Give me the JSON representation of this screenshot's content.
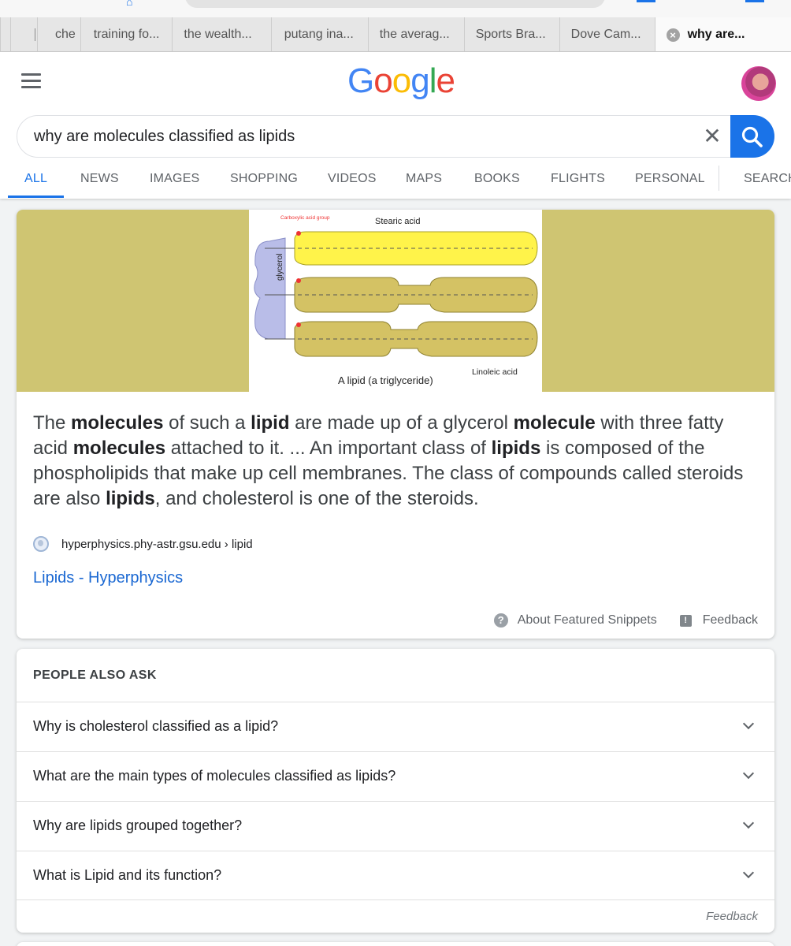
{
  "browser": {
    "tabs": [
      {
        "label": "che"
      },
      {
        "label": "training fo..."
      },
      {
        "label": "the wealth..."
      },
      {
        "label": "putang ina..."
      },
      {
        "label": "the averag..."
      },
      {
        "label": "Sports Bra..."
      },
      {
        "label": "Dove Cam..."
      },
      {
        "label": "why are..."
      }
    ]
  },
  "header": {
    "logo": [
      "G",
      "o",
      "o",
      "g",
      "l",
      "e"
    ],
    "logo_colors": [
      "#4285f4",
      "#ea4335",
      "#fbbc05",
      "#4285f4",
      "#34a853",
      "#ea4335"
    ],
    "search_value": "why are molecules classified as lipids",
    "clear_glyph": "✕"
  },
  "nav": {
    "tabs": [
      "ALL",
      "NEWS",
      "IMAGES",
      "SHOPPING",
      "VIDEOS",
      "MAPS",
      "BOOKS",
      "FLIGHTS",
      "PERSONAL",
      "SEARCH"
    ],
    "active": "ALL"
  },
  "snippet": {
    "image_labels": {
      "carboxylic": "Carboxylic acid group",
      "stearic": "Stearic acid",
      "glycerol": "glycerol",
      "linoleic": "Linoleic acid",
      "caption": "A lipid (a triglyceride)"
    },
    "text_parts": [
      {
        "t": "The ",
        "b": false
      },
      {
        "t": "molecules",
        "b": true
      },
      {
        "t": " of such a ",
        "b": false
      },
      {
        "t": "lipid",
        "b": true
      },
      {
        "t": " are made up of a glycerol ",
        "b": false
      },
      {
        "t": "molecule",
        "b": true
      },
      {
        "t": " with three fatty acid ",
        "b": false
      },
      {
        "t": "molecules",
        "b": true
      },
      {
        "t": " attached to it. ... An important class of ",
        "b": false
      },
      {
        "t": "lipids",
        "b": true
      },
      {
        "t": " is composed of the phospholipids that make up cell membranes. The class of compounds called steroids are also ",
        "b": false
      },
      {
        "t": "lipids",
        "b": true
      },
      {
        "t": ", and cholesterol is one of the steroids.",
        "b": false
      }
    ],
    "source": "hyperphysics.phy-astr.gsu.edu › lipid",
    "link_title": "Lipids - Hyperphysics",
    "about_label": "About Featured Snippets",
    "feedback_label": "Feedback"
  },
  "paa": {
    "title": "PEOPLE ALSO ASK",
    "questions": [
      "Why is cholesterol classified as a lipid?",
      "What are the main types of molecules classified as lipids?",
      "Why are lipids grouped together?",
      "What is Lipid and its function?"
    ],
    "feedback_label": "Feedback"
  },
  "colors": {
    "accent": "#1a73e8",
    "image_bg": "#cfc572",
    "stearic_fill": "#fff34a",
    "linoleic_fill": "#d4c264",
    "glycerol_fill": "#b9bde8"
  }
}
